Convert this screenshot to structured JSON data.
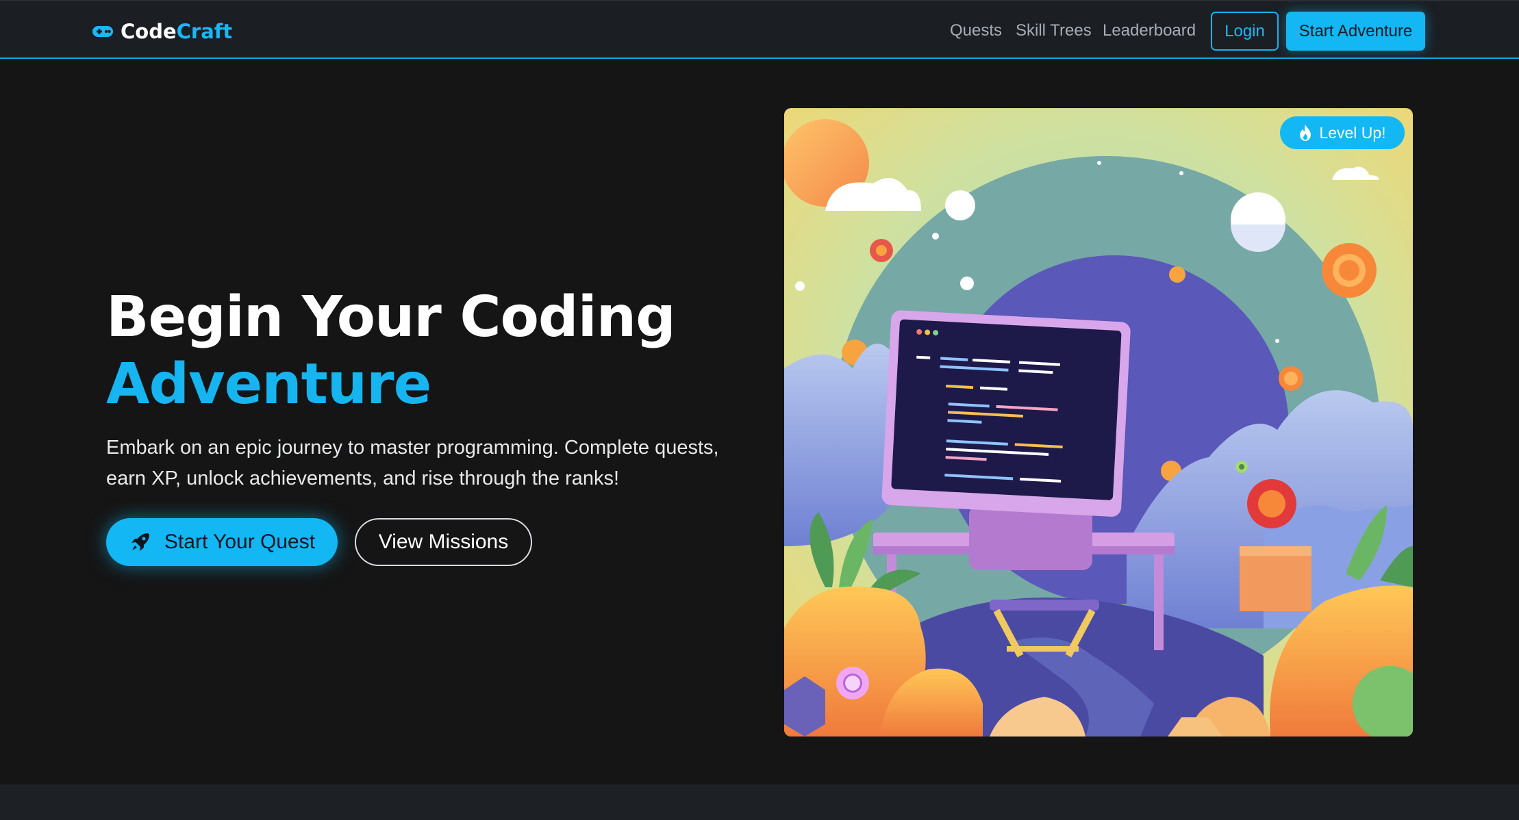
{
  "brand": {
    "code": "Code",
    "craft": "Craft",
    "icon": "gamepad-icon"
  },
  "nav": {
    "links": [
      "Quests",
      "Skill Trees",
      "Leaderboard"
    ],
    "login": "Login",
    "start": "Start Adventure"
  },
  "hero": {
    "title_line1": "Begin Your Coding",
    "title_line2": "Adventure",
    "subtitle": "Embark on an epic journey to master programming. Complete quests, earn XP, unlock achievements, and rise through the ranks!",
    "cta_primary": "Start Your Quest",
    "cta_primary_icon": "rocket-icon",
    "cta_secondary": "View Missions"
  },
  "illustration": {
    "badge_label": "Level Up!",
    "badge_icon": "flame-icon"
  },
  "colors": {
    "accent": "#13b7f3",
    "background": "#151515",
    "navbar": "#1b1e23"
  }
}
